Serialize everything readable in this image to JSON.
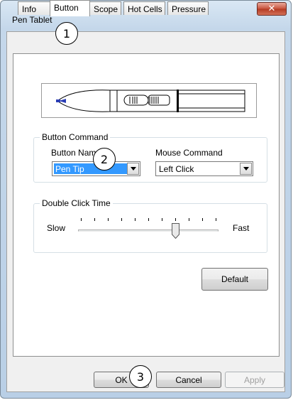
{
  "window": {
    "title": "Pen Tablet",
    "close_glyph": "✕"
  },
  "tabs": [
    {
      "label": "Info"
    },
    {
      "label": "Button"
    },
    {
      "label": "Scope"
    },
    {
      "label": "Hot Cells"
    },
    {
      "label": "Pressure"
    }
  ],
  "button_command": {
    "group_label": "Button Command",
    "button_name_label": "Button Name",
    "button_name_value": "Pen Tip",
    "mouse_command_label": "Mouse Command",
    "mouse_command_value": "Left Click"
  },
  "double_click": {
    "group_label": "Double Click Time",
    "slow_label": "Slow",
    "fast_label": "Fast",
    "tick_count": 11,
    "slider_position": 0.7
  },
  "buttons": {
    "default_label": "Default",
    "ok_label": "OK",
    "cancel_label": "Cancel",
    "apply_label": "Apply"
  },
  "callouts": [
    "1",
    "2",
    "3"
  ],
  "colors": {
    "accent": "#3399ff",
    "close": "#c7513b",
    "pen_tip": "#2a3db5"
  },
  "icons": {
    "close": "close-icon",
    "dropdown": "chevron-down-icon",
    "pen": "pen-illustration"
  }
}
